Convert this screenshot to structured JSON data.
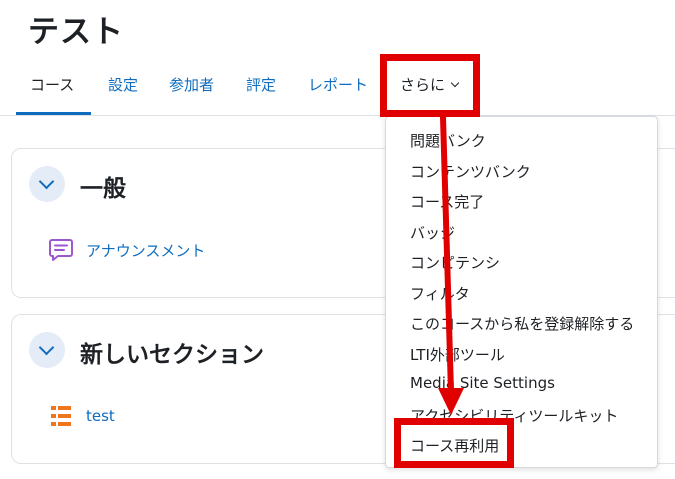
{
  "page": {
    "title": "テスト"
  },
  "nav": {
    "tabs": [
      {
        "label": "コース",
        "active": true
      },
      {
        "label": "設定"
      },
      {
        "label": "参加者"
      },
      {
        "label": "評定"
      },
      {
        "label": "レポート"
      }
    ],
    "more_label": "さらに"
  },
  "sections": [
    {
      "title": "一般",
      "activity": {
        "label": "アナウンスメント",
        "icon": "forum-icon"
      }
    },
    {
      "title": "新しいセクション",
      "activity": {
        "label": "test",
        "icon": "list-icon"
      }
    }
  ],
  "dropdown": {
    "items": [
      "問題バンク",
      "コンテンツバンク",
      "コース完了",
      "バッジ",
      "コンピテンシ",
      "フィルタ",
      "このコースから私を登録解除する",
      "LTI外部ツール",
      "Media Site Settings",
      "アクセシビリティツールキット",
      "コース再利用"
    ]
  },
  "colors": {
    "link": "#0f6cbf",
    "highlight": "#e00000",
    "forum_icon": "#9b59d0",
    "list_icon": "#f0761e"
  }
}
